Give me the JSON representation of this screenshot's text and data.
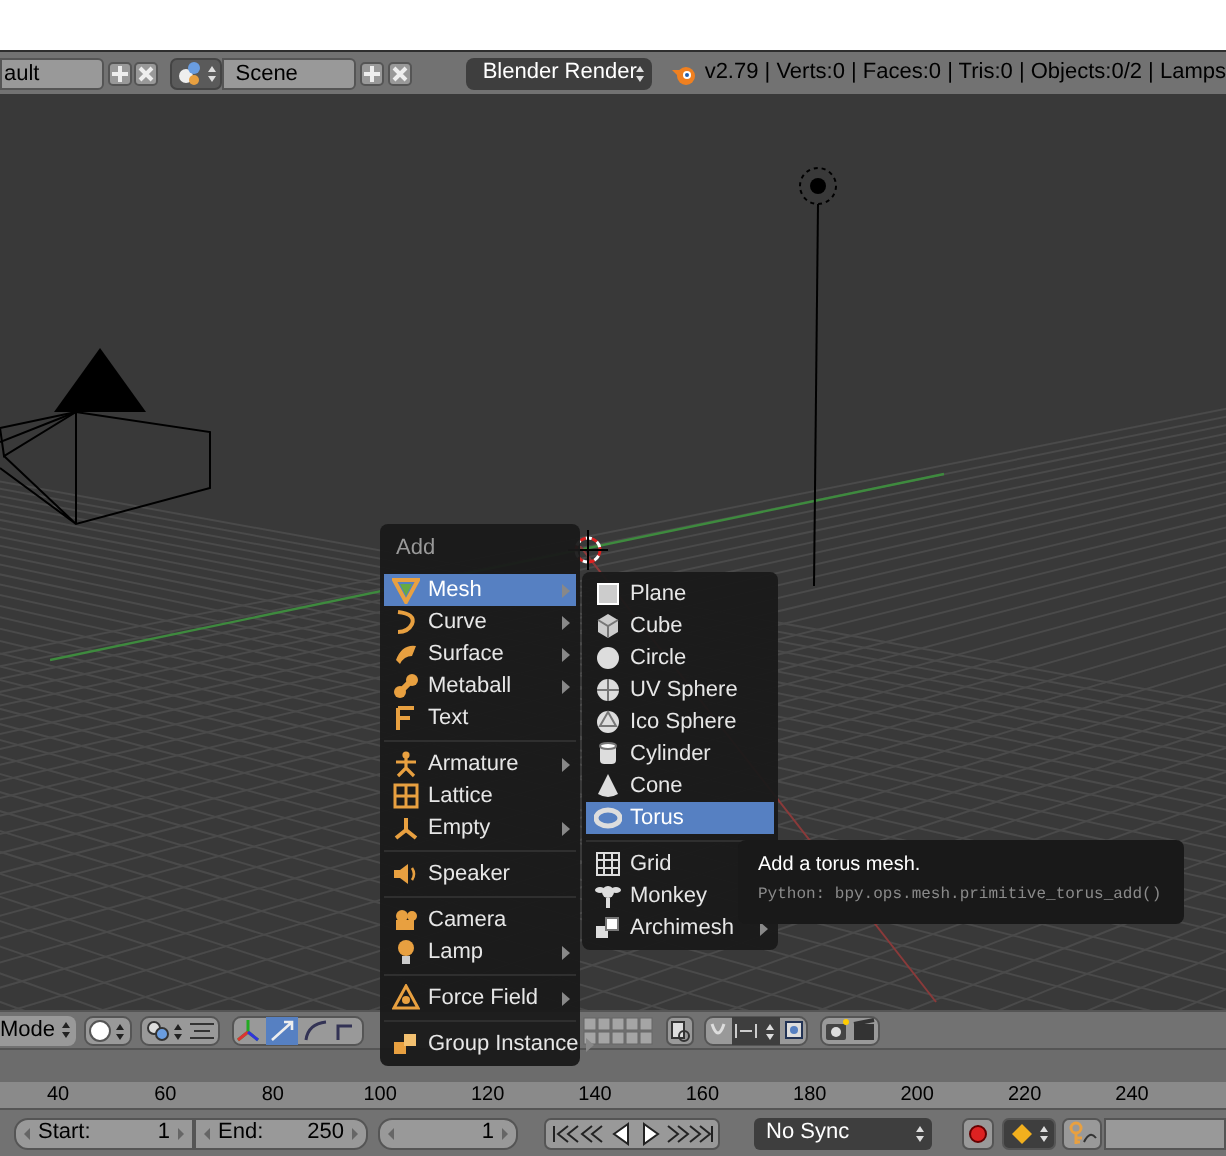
{
  "header": {
    "layout_field": "ault",
    "scene_field": "Scene",
    "render_engine": "Blender Render",
    "stats": "v2.79 | Verts:0 | Faces:0 | Tris:0 | Objects:0/2 | Lamps"
  },
  "toolbar": {
    "mode": "Mode"
  },
  "timeline": {
    "ruler": [
      "40",
      "60",
      "80",
      "100",
      "120",
      "140",
      "160",
      "180",
      "200",
      "220",
      "240"
    ]
  },
  "playback": {
    "start_label": "Start:",
    "start": "1",
    "end_label": "End:",
    "end": "250",
    "current_frame": "1",
    "sync": "No Sync"
  },
  "add_menu": {
    "title": "Add",
    "groups": [
      [
        {
          "label": "Mesh",
          "selected": true,
          "submenu": true
        },
        {
          "label": "Curve",
          "selected": false,
          "submenu": true
        },
        {
          "label": "Surface",
          "selected": false,
          "submenu": true
        },
        {
          "label": "Metaball",
          "selected": false,
          "submenu": true
        },
        {
          "label": "Text",
          "selected": false,
          "submenu": false
        }
      ],
      [
        {
          "label": "Armature",
          "selected": false,
          "submenu": true
        },
        {
          "label": "Lattice",
          "selected": false,
          "submenu": false
        },
        {
          "label": "Empty",
          "selected": false,
          "submenu": true
        }
      ],
      [
        {
          "label": "Speaker",
          "selected": false,
          "submenu": false
        }
      ],
      [
        {
          "label": "Camera",
          "selected": false,
          "submenu": false
        },
        {
          "label": "Lamp",
          "selected": false,
          "submenu": true
        }
      ],
      [
        {
          "label": "Force Field",
          "selected": false,
          "submenu": true
        }
      ],
      [
        {
          "label": "Group Instance",
          "selected": false,
          "submenu": true
        }
      ]
    ]
  },
  "mesh_submenu": {
    "groups": [
      [
        {
          "label": "Plane",
          "selected": false,
          "submenu": false
        },
        {
          "label": "Cube",
          "selected": false,
          "submenu": false
        },
        {
          "label": "Circle",
          "selected": false,
          "submenu": false
        },
        {
          "label": "UV Sphere",
          "selected": false,
          "submenu": false
        },
        {
          "label": "Ico Sphere",
          "selected": false,
          "submenu": false
        },
        {
          "label": "Cylinder",
          "selected": false,
          "submenu": false
        },
        {
          "label": "Cone",
          "selected": false,
          "submenu": false
        },
        {
          "label": "Torus",
          "selected": true,
          "submenu": false
        }
      ],
      [
        {
          "label": "Grid",
          "selected": false,
          "submenu": false
        },
        {
          "label": "Monkey",
          "selected": false,
          "submenu": false
        },
        {
          "label": "Archimesh",
          "selected": false,
          "submenu": true
        }
      ]
    ]
  },
  "tooltip": {
    "title": "Add a torus mesh.",
    "python": "Python: bpy.ops.mesh.primitive_torus_add()"
  }
}
